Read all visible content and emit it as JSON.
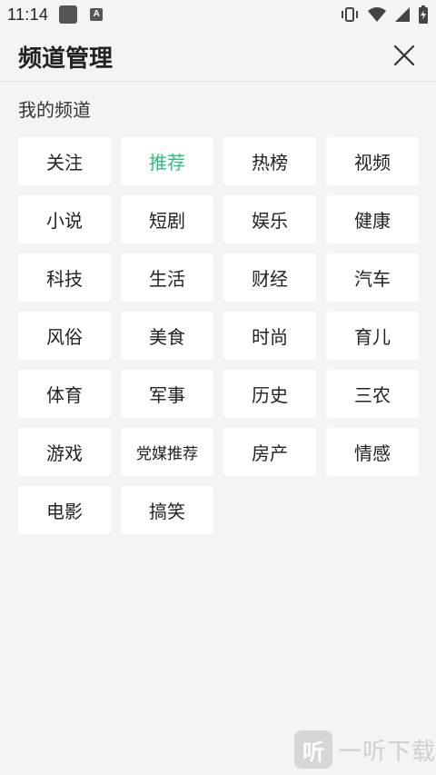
{
  "status_bar": {
    "time": "11:14",
    "a_badge": "A",
    "icons": [
      "vibrate-icon",
      "wifi-icon",
      "signal-icon",
      "battery-icon"
    ]
  },
  "header": {
    "title": "频道管理",
    "close_icon": "close-icon"
  },
  "section": {
    "title": "我的频道"
  },
  "channels": [
    {
      "label": "关注",
      "active": false
    },
    {
      "label": "推荐",
      "active": true
    },
    {
      "label": "热榜",
      "active": false
    },
    {
      "label": "视频",
      "active": false
    },
    {
      "label": "小说",
      "active": false
    },
    {
      "label": "短剧",
      "active": false
    },
    {
      "label": "娱乐",
      "active": false
    },
    {
      "label": "健康",
      "active": false
    },
    {
      "label": "科技",
      "active": false
    },
    {
      "label": "生活",
      "active": false
    },
    {
      "label": "财经",
      "active": false
    },
    {
      "label": "汽车",
      "active": false
    },
    {
      "label": "风俗",
      "active": false
    },
    {
      "label": "美食",
      "active": false
    },
    {
      "label": "时尚",
      "active": false
    },
    {
      "label": "育儿",
      "active": false
    },
    {
      "label": "体育",
      "active": false
    },
    {
      "label": "军事",
      "active": false
    },
    {
      "label": "历史",
      "active": false
    },
    {
      "label": "三农",
      "active": false
    },
    {
      "label": "游戏",
      "active": false
    },
    {
      "label": "党媒推荐",
      "active": false
    },
    {
      "label": "房产",
      "active": false
    },
    {
      "label": "情感",
      "active": false
    },
    {
      "label": "电影",
      "active": false
    },
    {
      "label": "搞笑",
      "active": false
    }
  ],
  "watermark": {
    "logo_char": "听",
    "text": "一听下载"
  },
  "colors": {
    "accent": "#2bbf7f",
    "background": "#f4f4f4",
    "chip": "#ffffff",
    "text": "#222222"
  }
}
